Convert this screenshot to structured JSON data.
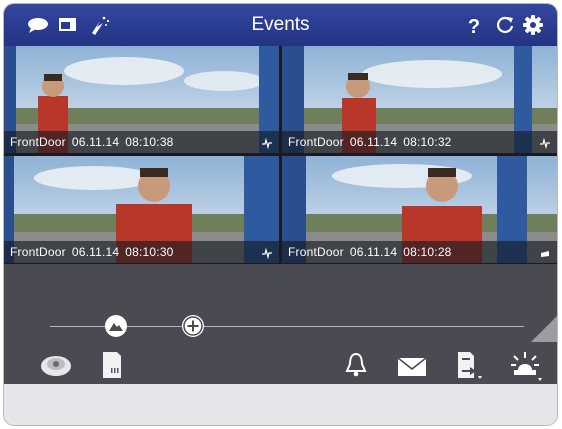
{
  "header": {
    "title": "Events"
  },
  "tiles": [
    {
      "camera": "FrontDoor",
      "date": "06.11.14",
      "time": "08:10:38"
    },
    {
      "camera": "FrontDoor",
      "date": "06.11.14",
      "time": "08:10:32"
    },
    {
      "camera": "FrontDoor",
      "date": "06.11.14",
      "time": "08:10:30"
    },
    {
      "camera": "FrontDoor",
      "date": "06.11.14",
      "time": "08:10:28"
    }
  ],
  "colors": {
    "toolbar": "#2a3a8c",
    "panel": "#4a4b52",
    "footer": "#e6e6ea"
  },
  "icons": {
    "header_left": [
      "chat-icon",
      "window-icon",
      "signal-icon"
    ],
    "header_right": [
      "help-icon",
      "refresh-icon",
      "settings-icon"
    ],
    "bottom_left": [
      "camera-dome-icon",
      "sd-card-icon"
    ],
    "bottom_right": [
      "bell-icon",
      "mail-icon",
      "network-share-icon",
      "alarm-light-icon"
    ]
  }
}
